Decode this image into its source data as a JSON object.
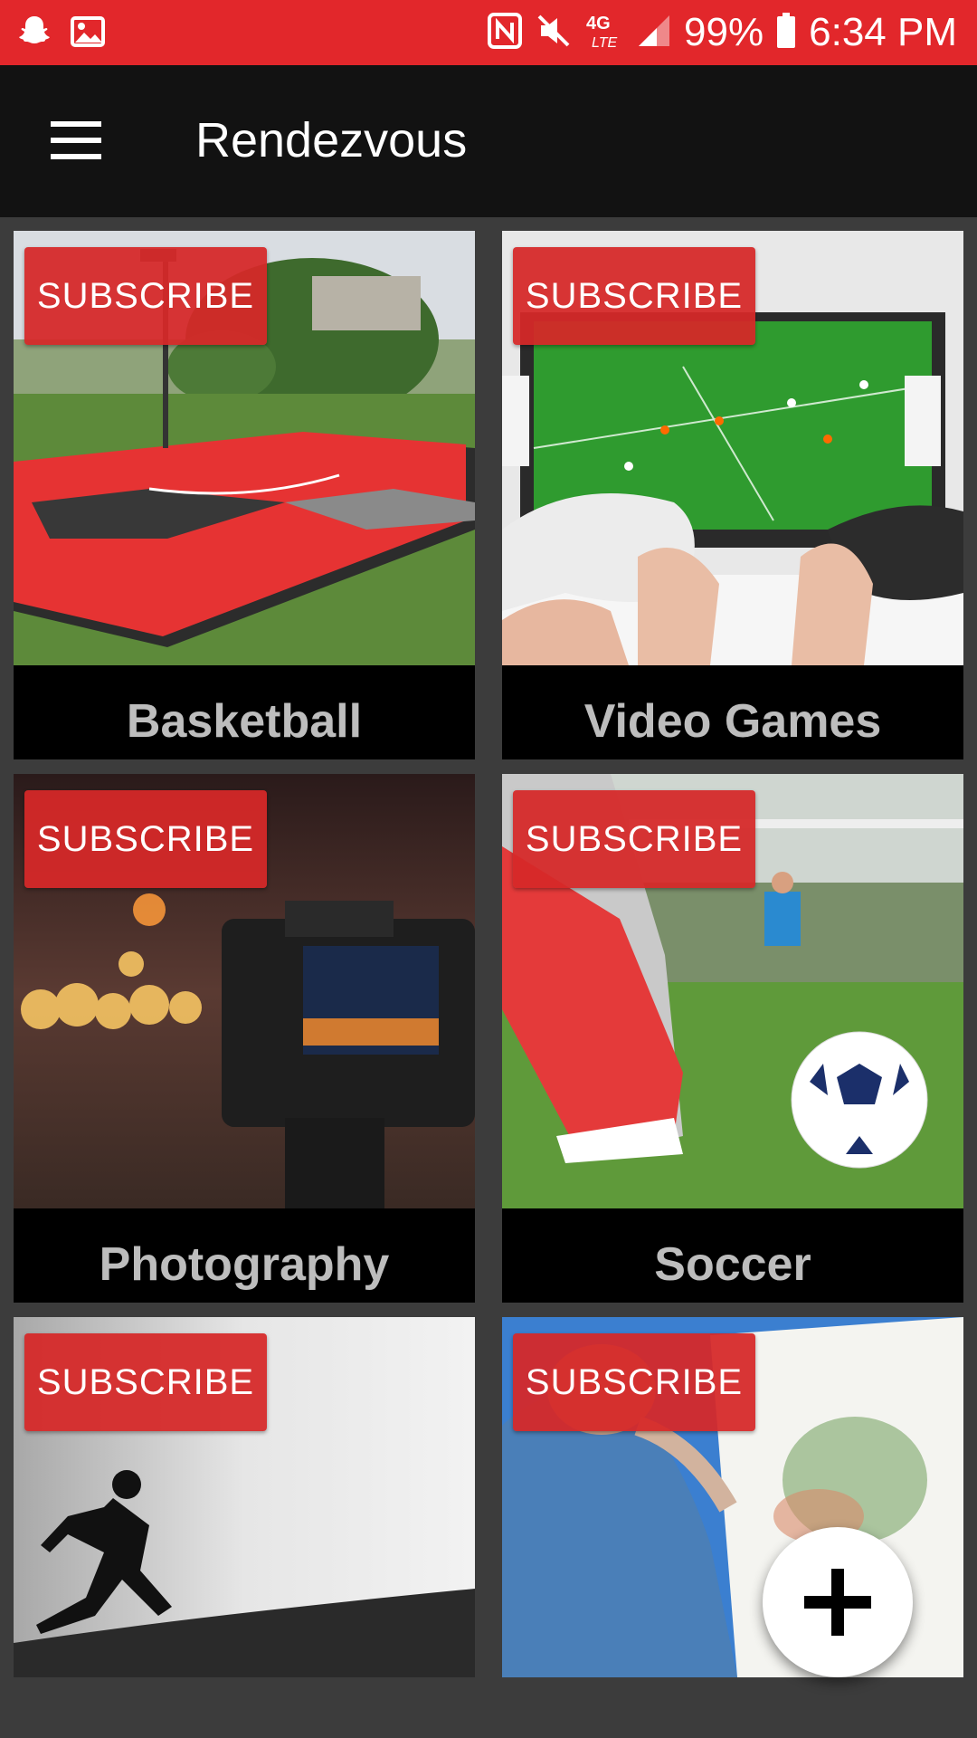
{
  "status_bar": {
    "battery": "99%",
    "time": "6:34 PM",
    "network": "4G LTE",
    "icons_left": [
      "snapchat-icon",
      "gallery-icon"
    ],
    "icons_right": [
      "nfc-icon",
      "mute-icon",
      "lte-icon",
      "signal-icon",
      "battery-icon"
    ]
  },
  "app_bar": {
    "title": "Rendezvous",
    "menu_icon": "hamburger-menu-icon"
  },
  "cards": [
    {
      "name": "Basketball",
      "subscribe_label": "SUBSCRIBE"
    },
    {
      "name": "Video Games",
      "subscribe_label": "SUBSCRIBE"
    },
    {
      "name": "Photography",
      "subscribe_label": "SUBSCRIBE"
    },
    {
      "name": "Soccer",
      "subscribe_label": "SUBSCRIBE"
    },
    {
      "name": "",
      "subscribe_label": "SUBSCRIBE"
    },
    {
      "name": "",
      "subscribe_label": "SUBSCRIBE"
    }
  ],
  "fab": {
    "icon": "plus-icon"
  },
  "colors": {
    "status_bar": "#e2272b",
    "app_bar": "#121212",
    "background": "#3c3c3c",
    "subscribe": "#d62828",
    "caption_text": "#bdbdbd"
  }
}
